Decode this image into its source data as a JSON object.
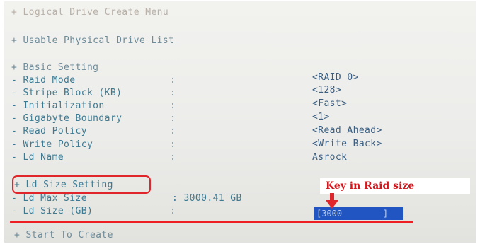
{
  "menu": {
    "create_menu": "+ Logical Drive Create Menu",
    "physical_list": "+ Usable Physical Drive List",
    "basic_setting": "+ Basic Setting",
    "ld_size_setting": "+ Ld Size Setting",
    "start_create": "+ Start To Create"
  },
  "settings": [
    {
      "label": "- Raid Mode",
      "value": "<RAID 0>"
    },
    {
      "label": "- Stripe Block (KB)",
      "value": "<128>"
    },
    {
      "label": "- Initialization",
      "value": "<Fast>"
    },
    {
      "label": "- Gigabyte Boundary",
      "value": "<1>"
    },
    {
      "label": "- Read Policy",
      "value": "<Read Ahead>"
    },
    {
      "label": "- Write Policy",
      "value": "<Write Back>"
    },
    {
      "label": "- Ld Name",
      "value": "Asrock"
    }
  ],
  "separator": ":",
  "size": {
    "max_label": "- Ld Max Size",
    "max_value": ": 3000.41 GB",
    "size_label": "- Ld Size (GB)",
    "size_value": "[3000        ]"
  },
  "annotation": {
    "text": "Key in Raid size",
    "color": "#e0262a"
  },
  "colors": {
    "label_text": "#3c7a92",
    "value_text": "#3b5f82",
    "highlight_field": "#2155c2"
  }
}
